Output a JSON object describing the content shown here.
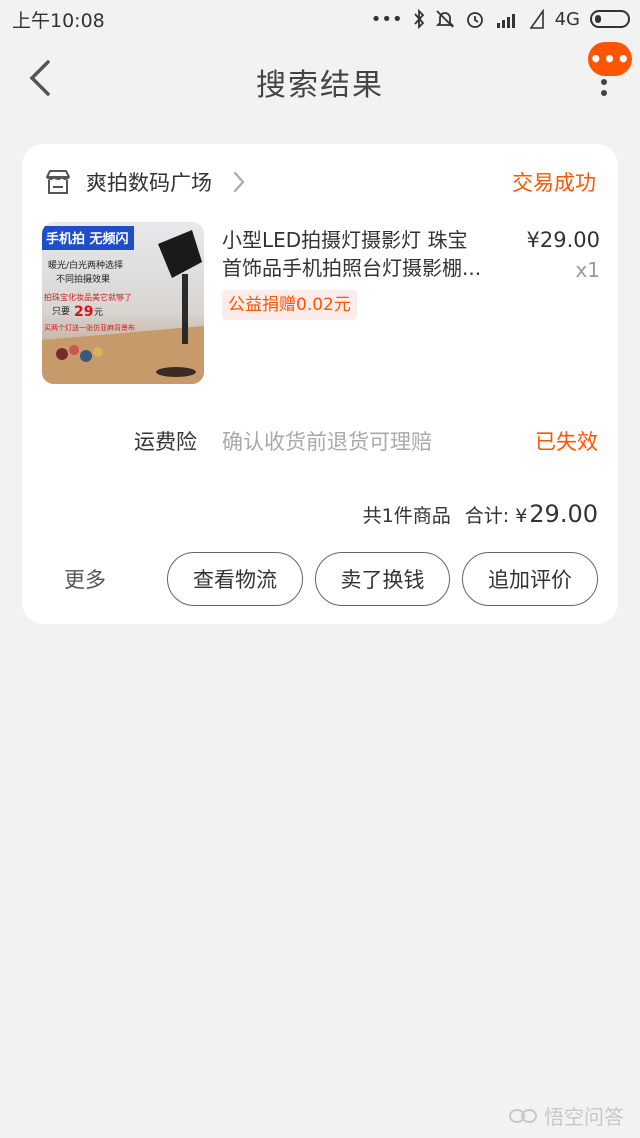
{
  "status_bar": {
    "time": "上午10:08",
    "signal_dots": "•••",
    "network": "4G"
  },
  "nav": {
    "title": "搜索结果",
    "badge": "•••"
  },
  "order": {
    "shop_name": "爽拍数码广场",
    "status": "交易成功",
    "item": {
      "title_line1": "小型LED拍摄灯摄影灯 珠宝",
      "title_line2": "首饰品手机拍照台灯摄影棚...",
      "price": "¥29.00",
      "qty": "x1",
      "charity": "公益捐赠0.02元"
    },
    "insurance": {
      "label": "运费险",
      "desc": "确认收货前退货可理赔",
      "status": "已失效"
    },
    "summary": {
      "count": "共1件商品",
      "total_label": "合计: ¥",
      "total_value": "29.00"
    },
    "actions": {
      "more": "更多",
      "logistics": "查看物流",
      "resell": "卖了换钱",
      "review": "追加评价"
    }
  },
  "thumbnail": {
    "badge": "手机拍 无频闪",
    "line1": "暖光/白光两种选择",
    "line2": "不同拍摄效果",
    "line3": "拍珠宝化妆品美它就够了",
    "price_prefix": "只要",
    "price": "29",
    "price_unit": "元",
    "line4": "买两个灯送一张仿亚麻背景布"
  },
  "watermark": {
    "text": "悟空问答"
  },
  "colors": {
    "accent": "#ff5500",
    "background": "#f2f2f2",
    "card": "#ffffff"
  }
}
